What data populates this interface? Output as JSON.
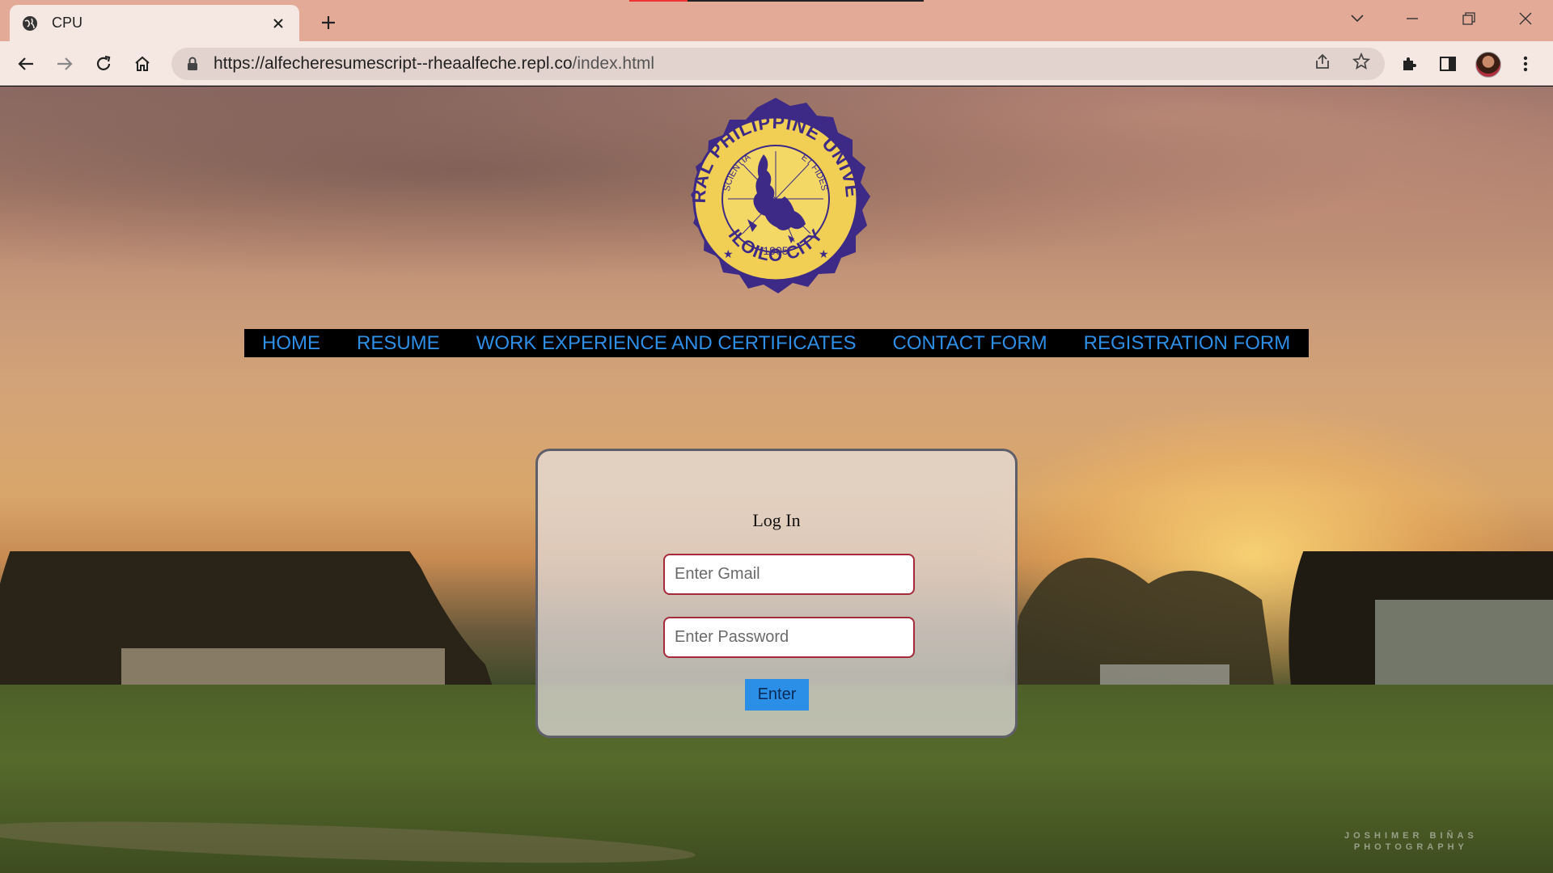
{
  "browser": {
    "tab_title": "CPU",
    "url_host": "https://alfecheresumescript--rheaalfeche.repl.co",
    "url_path": "/index.html"
  },
  "page": {
    "logo": {
      "text_top": "CENTRAL PHILIPPINE UNIVERSITY",
      "text_bottom": "ILOILO CITY",
      "motto_left": "SCIENTIA",
      "motto_right": "ET FIDES",
      "year": "1905"
    },
    "nav": [
      {
        "label": "HOME"
      },
      {
        "label": "RESUME"
      },
      {
        "label": "WORK EXPERIENCE AND CERTIFICATES"
      },
      {
        "label": "CONTACT FORM"
      },
      {
        "label": "REGISTRATION FORM"
      }
    ],
    "login": {
      "heading": "Log In",
      "gmail_placeholder": "Enter Gmail",
      "password_placeholder": "Enter Password",
      "submit_label": "Enter"
    },
    "watermark_line1": "JOSHIMER BIÑAS",
    "watermark_line2": "PHOTOGRAPHY"
  },
  "colors": {
    "nav_link": "#2e8fe6",
    "nav_bg": "#000000",
    "button": "#2b8fe8",
    "input_border": "#a52a3a",
    "seal_gold": "#f1cf55",
    "seal_purple": "#3d2a86"
  }
}
